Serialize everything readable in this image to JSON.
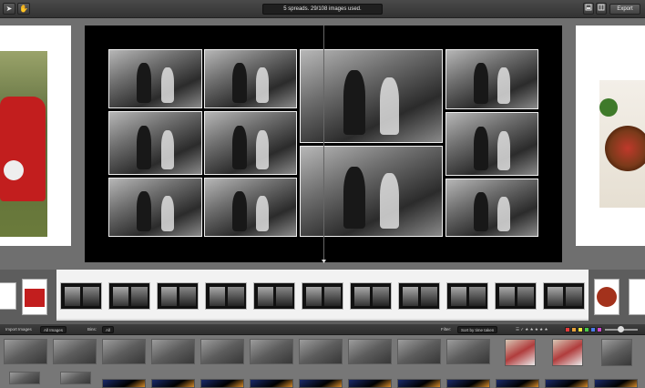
{
  "toolbar": {
    "status": "5 spreads. 29/108 images used.",
    "export_label": "Export",
    "icons": [
      "arrow-pointer-icon",
      "hand-icon",
      "single-page-view-icon",
      "spread-view-icon"
    ],
    "arrow_glyph": "➤",
    "hand_glyph": "✋"
  },
  "library_bar": {
    "import_label": "Import Images",
    "images_select": "All Images",
    "bins_label": "Bins:",
    "bins_select": "All",
    "filter_label": "Filter:",
    "sort_select": "Sort by time taken",
    "colors": [
      "#e23a3a",
      "#e8a23a",
      "#e8e23a",
      "#4ac84a",
      "#4a7ae8",
      "#c84ac8"
    ]
  },
  "filmstrip": {
    "spread_count": 11
  }
}
